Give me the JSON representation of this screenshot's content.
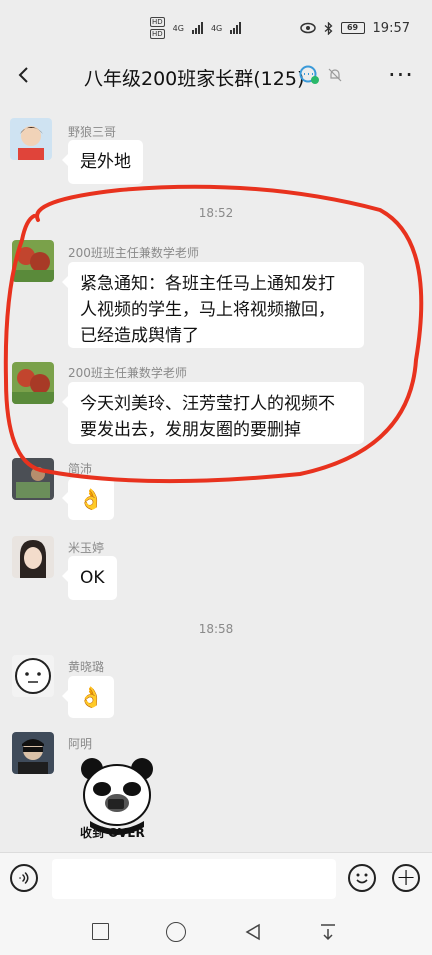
{
  "status_bar": {
    "time": "19:57",
    "battery": "69",
    "network_left_1": "4G",
    "network_left_2": "4G",
    "hd_1": "HD",
    "hd_2": "HD"
  },
  "header": {
    "title": "八年级200班家长群(125)",
    "back_icon": "chevron-left-icon",
    "more_icon": "more-dots-icon"
  },
  "messages": [
    {
      "sender": "野狼三哥",
      "text": "是外地"
    },
    {
      "time": "18:52"
    },
    {
      "sender": "200班班主任兼数学老师",
      "text_lines": [
        "紧急通知：各班主任马上通知发打",
        "人视频的学生，马上将视频撤回，",
        "已经造成舆情了"
      ]
    },
    {
      "sender": "200班主任兼数学老师",
      "text_lines": [
        "今天刘美玲、汪芳莹打人的视频不",
        "要发出去，发朋友圈的要删掉"
      ]
    },
    {
      "sender": "简沛",
      "emoji": "👌"
    },
    {
      "sender": "米玉婷",
      "text": "OK"
    },
    {
      "time": "18:58"
    },
    {
      "sender": "黄晓璐",
      "emoji": "👌"
    },
    {
      "sender": "阿明",
      "sticker_caption": "收到 OVER"
    }
  ],
  "colors": {
    "background": "#ededed",
    "bubble": "#ffffff",
    "annotation": "#e8321e"
  }
}
